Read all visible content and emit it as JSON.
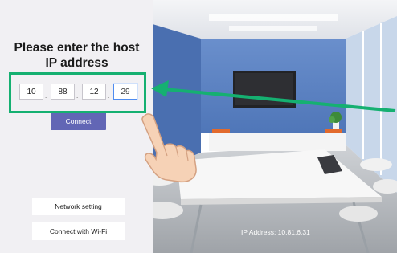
{
  "prompt": {
    "title_line1": "Please enter the host",
    "title_line2": "IP address"
  },
  "ip_input": {
    "octets": [
      "10",
      "88",
      "12",
      "29"
    ],
    "separator": "."
  },
  "buttons": {
    "connect": "Connect",
    "network_setting": "Network setting",
    "connect_wifi": "Connect with Wi-Fi"
  },
  "status": {
    "ip_address": "IP Address: 10.81.6.31"
  },
  "colors": {
    "accent": "#6266b5",
    "highlight": "#15b071",
    "panel": "#f1f0f3",
    "wall": "#5f86c6"
  },
  "icons": {
    "arrow": "arrow-icon",
    "hand": "pointing-hand-icon"
  }
}
